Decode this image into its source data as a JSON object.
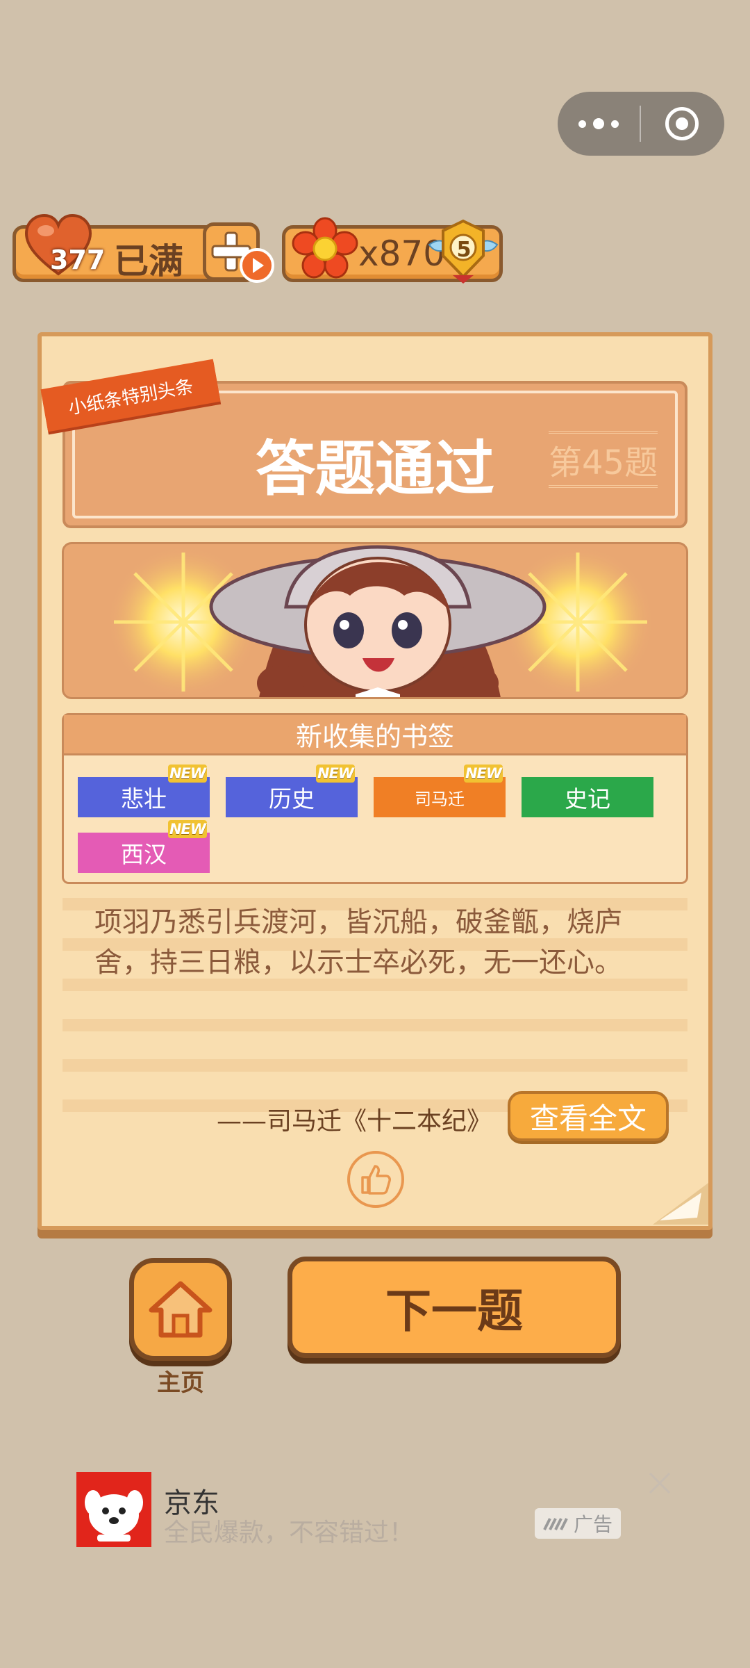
{
  "header": {
    "capsule": {
      "more_icon": "more-dots-icon",
      "close_icon": "target-circle-icon"
    }
  },
  "resources": {
    "hearts": {
      "count": "377",
      "status": "已满",
      "icon": "heart-icon",
      "add_icon": "plus-play-icon"
    },
    "flowers": {
      "count": "x870",
      "icon": "flower-icon",
      "level": "5",
      "level_icon": "winged-badge-icon"
    }
  },
  "card": {
    "ribbon": "小纸条特别头条",
    "title": "答题通过",
    "question_number": "第45题",
    "bookmarks_header": "新收集的书签",
    "new_label": "NEW",
    "bookmarks": [
      {
        "label": "悲壮",
        "color": "#5563db",
        "is_new": true
      },
      {
        "label": "历史",
        "color": "#5563db",
        "is_new": true
      },
      {
        "label": "司马迁",
        "color": "#f07f25",
        "is_new": true
      },
      {
        "label": "史记",
        "color": "#2ba84a",
        "is_new": false
      },
      {
        "label": "西汉",
        "color": "#e45bb5",
        "is_new": true
      }
    ],
    "quote": "项羽乃悉引兵渡河，皆沉船，破釜甑，烧庐舍，持三日粮，以示士卒必死，无一还心。",
    "source": "——司马迁《十二本纪》",
    "view_full_button": "查看全文",
    "like_icon": "thumbs-up-icon"
  },
  "actions": {
    "home_label": "主页",
    "home_icon": "house-icon",
    "next_label": "下一题"
  },
  "ad": {
    "title": "京东",
    "subtitle": "全民爆款，不容错过！",
    "badge": "广告",
    "close_icon": "close-x-icon"
  }
}
